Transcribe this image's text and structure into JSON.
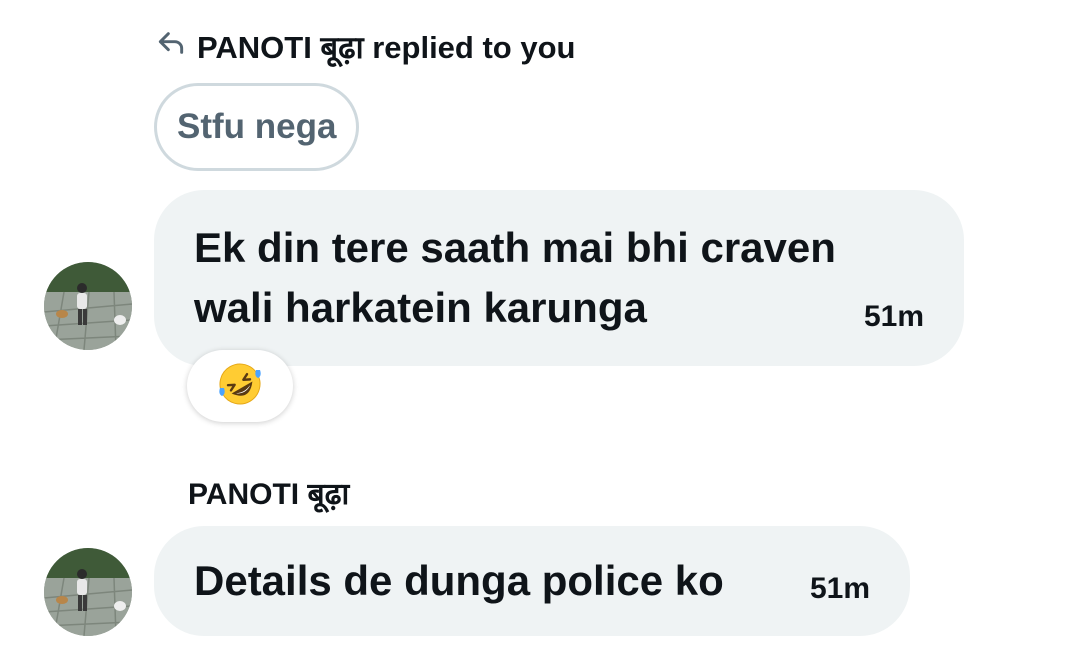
{
  "reply_header": {
    "icon": "reply-arrow-icon",
    "text": "PANOTI बूढ़ा replied to you"
  },
  "quoted_message": {
    "text": "Stfu nega"
  },
  "messages": [
    {
      "text_line1": "Ek din tere saath mai bhi craven",
      "text_line2": "wali harkatein karunga",
      "time": "51m",
      "reaction": {
        "emoji": "rolling-on-floor-laughing-emoji"
      }
    },
    {
      "sender": "PANOTI बूढ़ा",
      "text": "Details de dunga police ko",
      "time": "51m"
    }
  ],
  "colors": {
    "bubble_bg": "#eff3f4",
    "quoted_border": "#cfd9de",
    "quoted_text": "#536471",
    "text": "#0f1419"
  }
}
